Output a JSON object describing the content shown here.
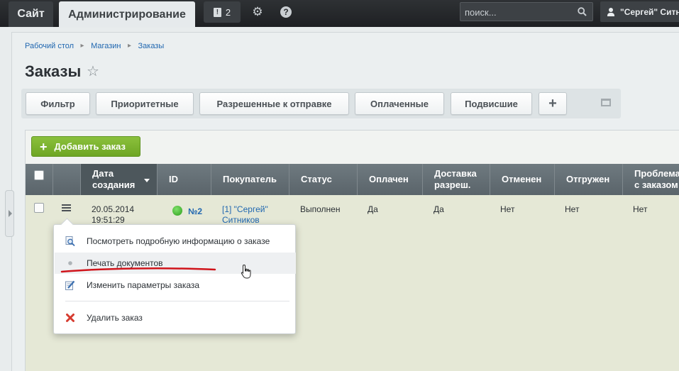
{
  "topbar": {
    "site_tab": "Сайт",
    "admin_tab": "Администрирование",
    "notifications_count": "2",
    "search_placeholder": "поиск...",
    "user_name": "\"Сергей\" Ситн"
  },
  "breadcrumb": [
    "Рабочий стол",
    "Магазин",
    "Заказы"
  ],
  "page_title": "Заказы",
  "filters": [
    "Фильтр",
    "Приоритетные",
    "Разрешенные к отправке",
    "Оплаченные",
    "Подвисшие",
    "+"
  ],
  "add_order_label": "Добавить заказ",
  "table": {
    "columns": [
      "Дата создания",
      "ID",
      "Покупатель",
      "Статус",
      "Оплачен",
      "Доставка разреш.",
      "Отменен",
      "Отгружен",
      "Проблема с заказом"
    ],
    "column_lines": [
      [
        "Дата",
        "создания"
      ],
      [
        "ID"
      ],
      [
        "Покупатель"
      ],
      [
        "Статус"
      ],
      [
        "Оплачен"
      ],
      [
        "Доставка",
        "разреш."
      ],
      [
        "Отменен"
      ],
      [
        "Отгружен"
      ],
      [
        "Проблема",
        "с заказом"
      ]
    ],
    "sorted_column": "Дата создания",
    "rows": [
      {
        "date": "20.05.2014",
        "time": "19:51:29",
        "id": "№2",
        "buyer_line1": "[1] \"Сергей\"",
        "buyer_line2": "Ситников",
        "status": "Выполнен",
        "paid": "Да",
        "delivery_allowed": "Да",
        "canceled": "Нет",
        "shipped": "Нет",
        "problem": "Нет"
      }
    ]
  },
  "context_menu": {
    "items": [
      {
        "label": "Посмотреть подробную информацию о заказе",
        "icon": "magnifier-icon"
      },
      {
        "label": "Печать документов",
        "icon": "bullet-icon"
      },
      {
        "label": "Изменить параметры заказа",
        "icon": "edit-icon"
      },
      {
        "label": "Удалить заказ",
        "icon": "delete-icon"
      }
    ]
  },
  "colors": {
    "topbar": "#1e2023",
    "accent_green": "#7ab32f",
    "link_blue": "#2067b0",
    "row_bg": "#e5e8d6",
    "annotation_red": "#d0141b"
  }
}
